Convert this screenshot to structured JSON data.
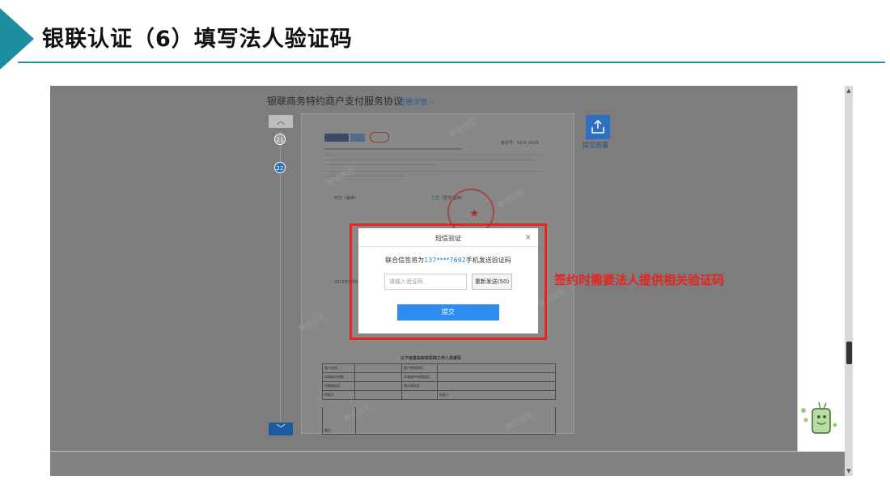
{
  "slide": {
    "title": "银联认证（6）填写法人验证码",
    "annotation": "签约时需要法人提供相关验证码",
    "accent_color": "#1d8ea0",
    "annotation_color": "#e8231d"
  },
  "document": {
    "title": "银联商务特约商户支付服务协议",
    "detail_link": "签署详情",
    "pages": [
      "21",
      "22"
    ],
    "current_page": "22",
    "submit_label": "提交签署",
    "version": "版本号：V2.0_2020",
    "party_a": "甲方（盖章）",
    "party_b": "乙方（签字/盖章）",
    "date": "2021年6月9日",
    "watermark": "联合信签",
    "info_table_title": "以下信息由收单机构工作人员填写",
    "info_table": [
      [
        "客户经理",
        "",
        "客户经理电话",
        ""
      ],
      [
        "终端维护经理",
        "",
        "终端维护经理电话",
        ""
      ],
      [
        "所属服务区",
        "",
        "细分服务区",
        ""
      ],
      [
        "拓展方",
        "",
        "",
        "拓展人"
      ]
    ],
    "remark_label": "备注"
  },
  "dialog": {
    "title": "短信验证",
    "close": "×",
    "message_prefix": "联合信签将为",
    "phone": "137****7692",
    "message_suffix": "手机发送验证码",
    "input_placeholder": "请输入验证码",
    "resend_label": "重新发送(50)",
    "submit_label": "提交"
  }
}
